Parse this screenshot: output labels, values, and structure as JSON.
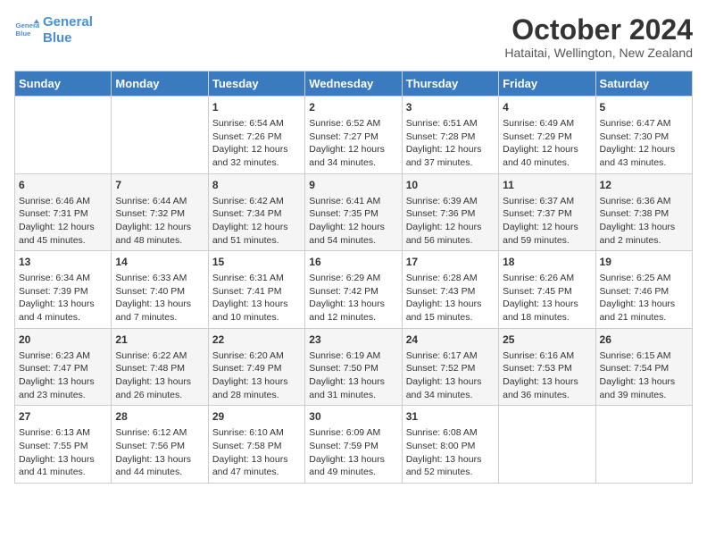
{
  "header": {
    "logo_line1": "General",
    "logo_line2": "Blue",
    "month": "October 2024",
    "location": "Hataitai, Wellington, New Zealand"
  },
  "days_of_week": [
    "Sunday",
    "Monday",
    "Tuesday",
    "Wednesday",
    "Thursday",
    "Friday",
    "Saturday"
  ],
  "weeks": [
    [
      {
        "day": "",
        "info": ""
      },
      {
        "day": "",
        "info": ""
      },
      {
        "day": "1",
        "info": "Sunrise: 6:54 AM\nSunset: 7:26 PM\nDaylight: 12 hours and 32 minutes."
      },
      {
        "day": "2",
        "info": "Sunrise: 6:52 AM\nSunset: 7:27 PM\nDaylight: 12 hours and 34 minutes."
      },
      {
        "day": "3",
        "info": "Sunrise: 6:51 AM\nSunset: 7:28 PM\nDaylight: 12 hours and 37 minutes."
      },
      {
        "day": "4",
        "info": "Sunrise: 6:49 AM\nSunset: 7:29 PM\nDaylight: 12 hours and 40 minutes."
      },
      {
        "day": "5",
        "info": "Sunrise: 6:47 AM\nSunset: 7:30 PM\nDaylight: 12 hours and 43 minutes."
      }
    ],
    [
      {
        "day": "6",
        "info": "Sunrise: 6:46 AM\nSunset: 7:31 PM\nDaylight: 12 hours and 45 minutes."
      },
      {
        "day": "7",
        "info": "Sunrise: 6:44 AM\nSunset: 7:32 PM\nDaylight: 12 hours and 48 minutes."
      },
      {
        "day": "8",
        "info": "Sunrise: 6:42 AM\nSunset: 7:34 PM\nDaylight: 12 hours and 51 minutes."
      },
      {
        "day": "9",
        "info": "Sunrise: 6:41 AM\nSunset: 7:35 PM\nDaylight: 12 hours and 54 minutes."
      },
      {
        "day": "10",
        "info": "Sunrise: 6:39 AM\nSunset: 7:36 PM\nDaylight: 12 hours and 56 minutes."
      },
      {
        "day": "11",
        "info": "Sunrise: 6:37 AM\nSunset: 7:37 PM\nDaylight: 12 hours and 59 minutes."
      },
      {
        "day": "12",
        "info": "Sunrise: 6:36 AM\nSunset: 7:38 PM\nDaylight: 13 hours and 2 minutes."
      }
    ],
    [
      {
        "day": "13",
        "info": "Sunrise: 6:34 AM\nSunset: 7:39 PM\nDaylight: 13 hours and 4 minutes."
      },
      {
        "day": "14",
        "info": "Sunrise: 6:33 AM\nSunset: 7:40 PM\nDaylight: 13 hours and 7 minutes."
      },
      {
        "day": "15",
        "info": "Sunrise: 6:31 AM\nSunset: 7:41 PM\nDaylight: 13 hours and 10 minutes."
      },
      {
        "day": "16",
        "info": "Sunrise: 6:29 AM\nSunset: 7:42 PM\nDaylight: 13 hours and 12 minutes."
      },
      {
        "day": "17",
        "info": "Sunrise: 6:28 AM\nSunset: 7:43 PM\nDaylight: 13 hours and 15 minutes."
      },
      {
        "day": "18",
        "info": "Sunrise: 6:26 AM\nSunset: 7:45 PM\nDaylight: 13 hours and 18 minutes."
      },
      {
        "day": "19",
        "info": "Sunrise: 6:25 AM\nSunset: 7:46 PM\nDaylight: 13 hours and 21 minutes."
      }
    ],
    [
      {
        "day": "20",
        "info": "Sunrise: 6:23 AM\nSunset: 7:47 PM\nDaylight: 13 hours and 23 minutes."
      },
      {
        "day": "21",
        "info": "Sunrise: 6:22 AM\nSunset: 7:48 PM\nDaylight: 13 hours and 26 minutes."
      },
      {
        "day": "22",
        "info": "Sunrise: 6:20 AM\nSunset: 7:49 PM\nDaylight: 13 hours and 28 minutes."
      },
      {
        "day": "23",
        "info": "Sunrise: 6:19 AM\nSunset: 7:50 PM\nDaylight: 13 hours and 31 minutes."
      },
      {
        "day": "24",
        "info": "Sunrise: 6:17 AM\nSunset: 7:52 PM\nDaylight: 13 hours and 34 minutes."
      },
      {
        "day": "25",
        "info": "Sunrise: 6:16 AM\nSunset: 7:53 PM\nDaylight: 13 hours and 36 minutes."
      },
      {
        "day": "26",
        "info": "Sunrise: 6:15 AM\nSunset: 7:54 PM\nDaylight: 13 hours and 39 minutes."
      }
    ],
    [
      {
        "day": "27",
        "info": "Sunrise: 6:13 AM\nSunset: 7:55 PM\nDaylight: 13 hours and 41 minutes."
      },
      {
        "day": "28",
        "info": "Sunrise: 6:12 AM\nSunset: 7:56 PM\nDaylight: 13 hours and 44 minutes."
      },
      {
        "day": "29",
        "info": "Sunrise: 6:10 AM\nSunset: 7:58 PM\nDaylight: 13 hours and 47 minutes."
      },
      {
        "day": "30",
        "info": "Sunrise: 6:09 AM\nSunset: 7:59 PM\nDaylight: 13 hours and 49 minutes."
      },
      {
        "day": "31",
        "info": "Sunrise: 6:08 AM\nSunset: 8:00 PM\nDaylight: 13 hours and 52 minutes."
      },
      {
        "day": "",
        "info": ""
      },
      {
        "day": "",
        "info": ""
      }
    ]
  ]
}
